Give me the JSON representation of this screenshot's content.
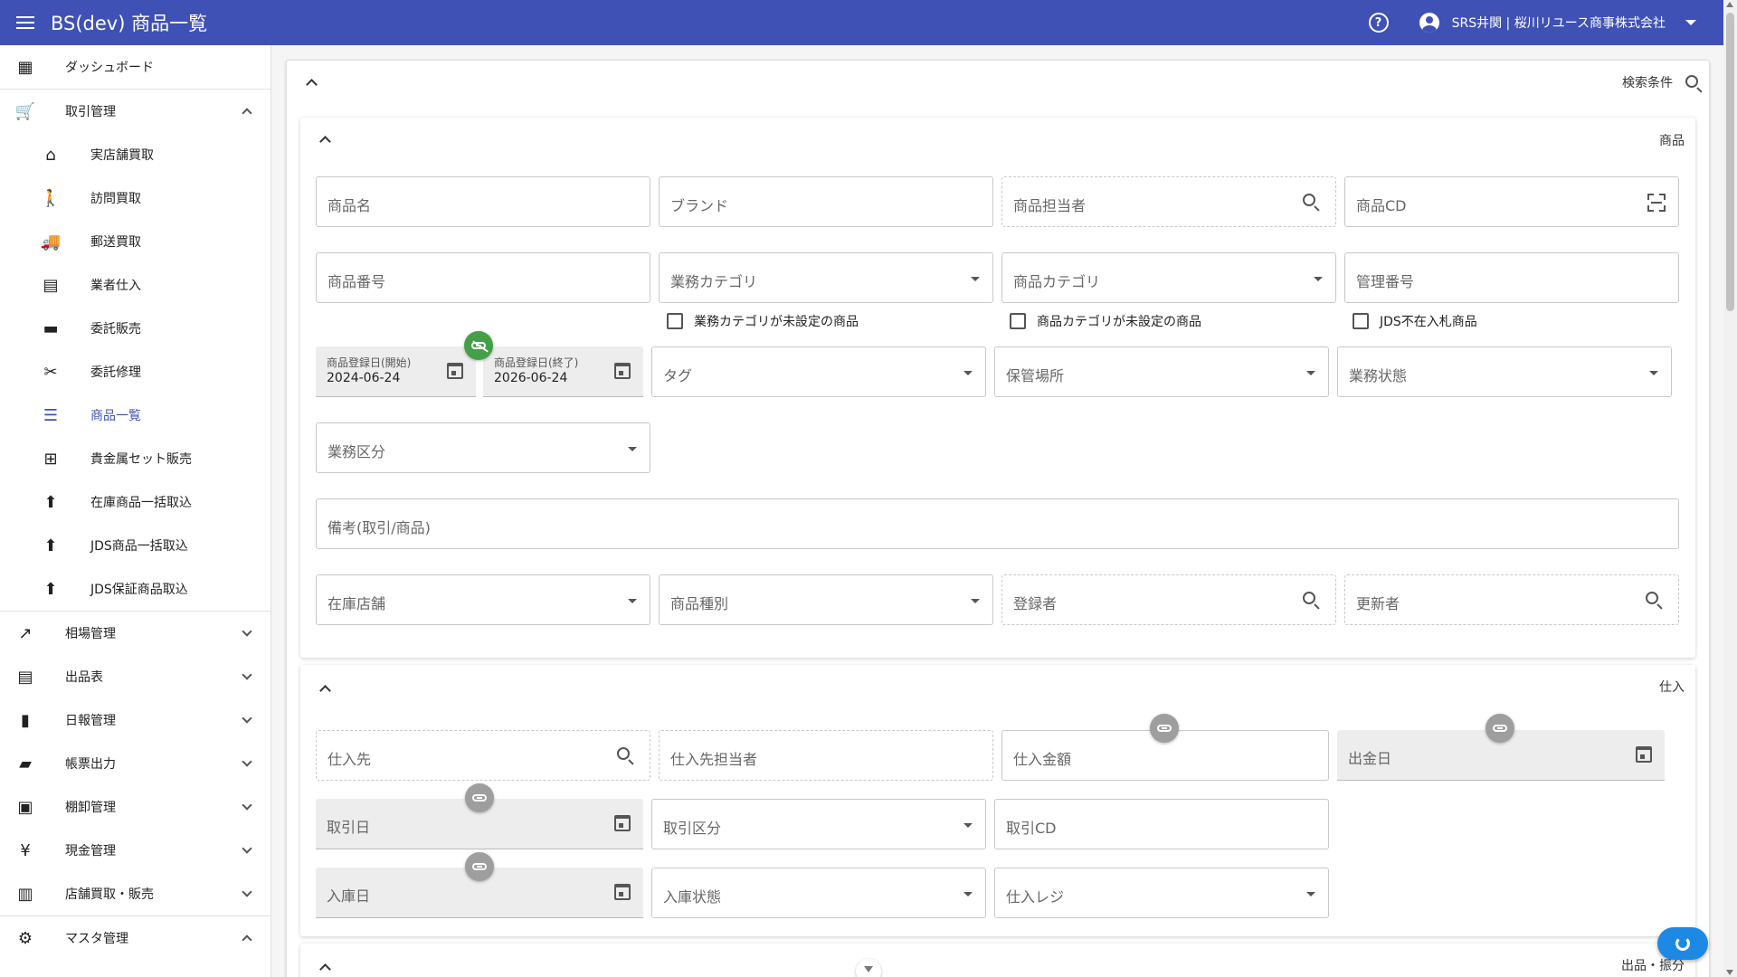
{
  "appbar": {
    "title": "BS(dev) 商品一覧",
    "user": "SRS井関 | 桜川リユース商事株式会社"
  },
  "sidebar": {
    "items": [
      {
        "label": "ダッシュボード",
        "icon": "dashboard-icon"
      },
      {
        "label": "取引管理",
        "icon": "cart-icon"
      },
      {
        "label": "実店舗買取",
        "icon": "store-icon"
      },
      {
        "label": "訪問買取",
        "icon": "walk-icon"
      },
      {
        "label": "郵送買取",
        "icon": "truck-icon"
      },
      {
        "label": "業者仕入",
        "icon": "building-icon"
      },
      {
        "label": "委託販売",
        "icon": "register-icon"
      },
      {
        "label": "委託修理",
        "icon": "tools-icon"
      },
      {
        "label": "商品一覧",
        "icon": "list-icon"
      },
      {
        "label": "貴金属セット販売",
        "icon": "grid-icon"
      },
      {
        "label": "在庫商品一括取込",
        "icon": "upload-icon"
      },
      {
        "label": "JDS商品一括取込",
        "icon": "upload-icon"
      },
      {
        "label": "JDS保証商品取込",
        "icon": "upload-icon"
      },
      {
        "label": "相場管理",
        "icon": "trend-icon"
      },
      {
        "label": "出品表",
        "icon": "sheet-icon"
      },
      {
        "label": "日報管理",
        "icon": "document-icon"
      },
      {
        "label": "帳票出力",
        "icon": "note-icon"
      },
      {
        "label": "棚卸管理",
        "icon": "archive-icon"
      },
      {
        "label": "現金管理",
        "icon": "yen-icon"
      },
      {
        "label": "店舗買取・販売",
        "icon": "shop-icon"
      },
      {
        "label": "マスタ管理",
        "icon": "gear-icon"
      }
    ],
    "active": "商品一覧"
  },
  "search": {
    "title": "検索条件"
  },
  "product": {
    "title": "商品",
    "name": "商品名",
    "brand": "ブランド",
    "manager": "商品担当者",
    "cd": "商品CD",
    "number": "商品番号",
    "biz_category": "業務カテゴリ",
    "category": "商品カテゴリ",
    "mgmt_no": "管理番号",
    "chk_biz_category": "業務カテゴリが未設定の商品",
    "chk_category": "商品カテゴリが未設定の商品",
    "chk_jds": "JDS不在入札商品",
    "reg_start_label": "商品登録日(開始)",
    "reg_start_value": "2024-06-24",
    "reg_end_label": "商品登録日(終了)",
    "reg_end_value": "2026-06-24",
    "tag": "タグ",
    "storage": "保管場所",
    "status": "業務状態",
    "division": "業務区分",
    "remarks": "備考(取引/商品)",
    "store": "在庫店舗",
    "type": "商品種別",
    "registrant": "登録者",
    "updater": "更新者"
  },
  "purchase": {
    "title": "仕入",
    "supplier": "仕入先",
    "supplier_contact": "仕入先担当者",
    "amount": "仕入金額",
    "payment_date": "出金日",
    "trade_date": "取引日",
    "trade_type": "取引区分",
    "trade_cd": "取引CD",
    "stock_date": "入庫日",
    "stock_status": "入庫状態",
    "register": "仕入レジ"
  },
  "listing": {
    "title": "出品・振分"
  }
}
